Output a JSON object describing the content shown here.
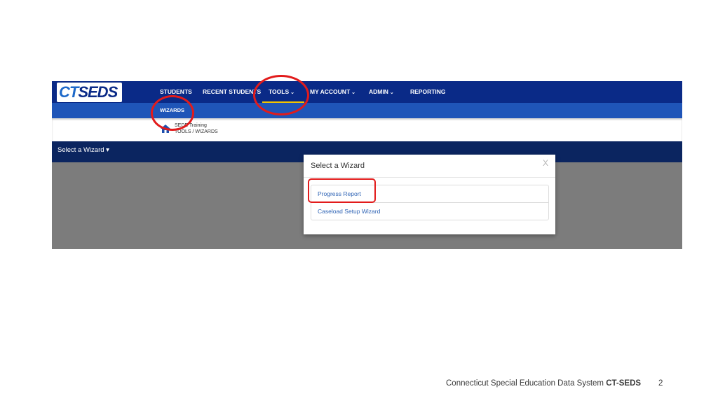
{
  "logo": {
    "part1": "CT",
    "part2": "SEDS"
  },
  "nav": {
    "items": [
      {
        "label": "STUDENTS",
        "chevron": false
      },
      {
        "label": "RECENT STUDENTS",
        "chevron": false
      },
      {
        "label": "TOOLS",
        "chevron": true
      },
      {
        "label": "MY ACCOUNT",
        "chevron": true
      },
      {
        "label": "ADMIN",
        "chevron": true
      },
      {
        "label": "REPORTING",
        "chevron": false
      }
    ],
    "active": "TOOLS",
    "chevron_glyph": "⌄"
  },
  "subnav": {
    "item": "WIZARDS"
  },
  "breadcrumb": {
    "home_icon": "home-icon",
    "title": "SEDE Training",
    "path": "TOOLS  /  WIZARDS"
  },
  "wizard_bar": {
    "label": "Select a Wizard ▾"
  },
  "modal": {
    "title": "Select a Wizard",
    "close": "X",
    "options": [
      "Progress Report",
      "Caseload Setup Wizard"
    ]
  },
  "footer": {
    "text": "Connecticut Special Education Data System ",
    "brand": "CT-SEDS",
    "page": "2"
  },
  "colors": {
    "nav_bg": "#0a2a87",
    "subnav_bg": "#1f55b8",
    "wizbar_bg": "#0b2560",
    "overlay_gray": "#7c7c7c",
    "active_underline": "#f2c400",
    "annotation_red": "#e21b1b",
    "link_blue": "#2f64b5"
  }
}
